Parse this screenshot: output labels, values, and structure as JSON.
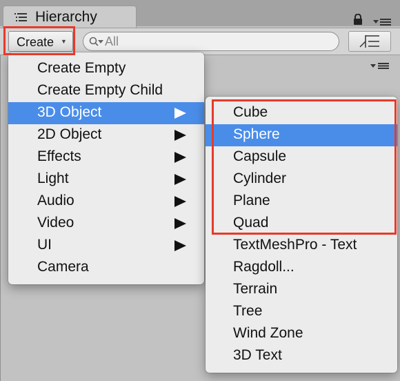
{
  "tab": {
    "title": "Hierarchy"
  },
  "toolbar": {
    "create_label": "Create",
    "search_placeholder": "All"
  },
  "create_menu": {
    "items": [
      {
        "label": "Create Empty",
        "submenu": false
      },
      {
        "label": "Create Empty Child",
        "submenu": false
      },
      {
        "label": "3D Object",
        "submenu": true,
        "selected": true
      },
      {
        "label": "2D Object",
        "submenu": true
      },
      {
        "label": "Effects",
        "submenu": true
      },
      {
        "label": "Light",
        "submenu": true
      },
      {
        "label": "Audio",
        "submenu": true
      },
      {
        "label": "Video",
        "submenu": true
      },
      {
        "label": "UI",
        "submenu": true
      },
      {
        "label": "Camera",
        "submenu": false
      }
    ]
  },
  "object_submenu": {
    "items": [
      {
        "label": "Cube"
      },
      {
        "label": "Sphere",
        "selected": true
      },
      {
        "label": "Capsule"
      },
      {
        "label": "Cylinder"
      },
      {
        "label": "Plane"
      },
      {
        "label": "Quad"
      },
      {
        "label": "TextMeshPro - Text"
      },
      {
        "label": "Ragdoll..."
      },
      {
        "label": "Terrain"
      },
      {
        "label": "Tree"
      },
      {
        "label": "Wind Zone"
      },
      {
        "label": "3D Text"
      }
    ]
  },
  "colors": {
    "selection": "#4a8de8",
    "annotation": "#e63a2a",
    "menu_bg": "#ececec"
  },
  "icons": [
    "hierarchy-list-icon",
    "lock-icon",
    "tab-menu-icon",
    "search-icon",
    "filter-icon",
    "submenu-arrow-icon"
  ]
}
